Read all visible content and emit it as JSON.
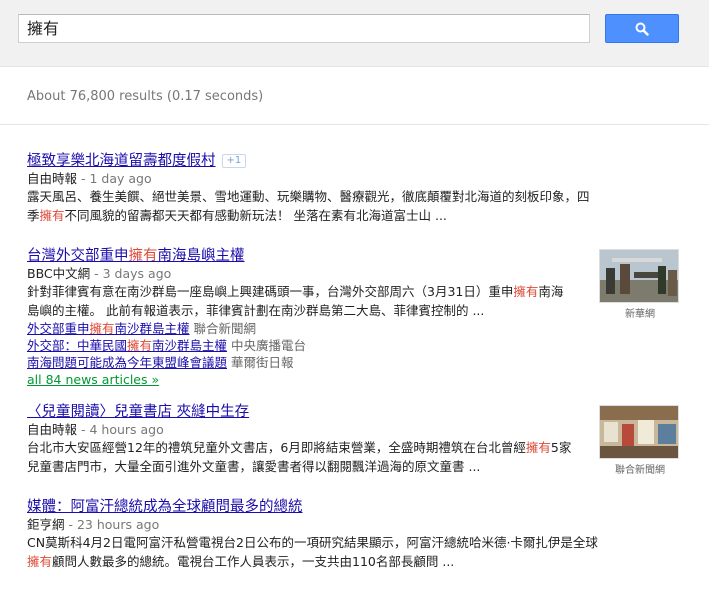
{
  "search": {
    "query": "擁有"
  },
  "stats": "About 76,800 results (0.17 seconds)",
  "results": [
    {
      "title_parts": [
        "極致享樂北海道留壽都度假村",
        "",
        ""
      ],
      "plus_badge": "+1",
      "source": "自由時報",
      "time": " - 1 day ago",
      "snippet_lines": [
        [
          "露天風呂、養生美饌、絕世美景、雪地運動、玩樂購物、醫療觀光，徹底顛覆對北海道的刻板印象，四",
          "",
          ""
        ],
        [
          "季",
          "擁有",
          "不同風貌的留壽都天天都有感動新玩法！ 坐落在素有北海道富士山 ..."
        ]
      ]
    },
    {
      "title_parts": [
        "台灣外交部重申",
        "擁有",
        "南海島嶼主權"
      ],
      "source": "BBC中文網",
      "time": " - 3 days ago",
      "snippet_lines": [
        [
          "針對菲律賓有意在南沙群島一座島嶼上興建碼頭一事，台灣外交部周六（3月31日）重申",
          "擁有",
          "南海"
        ],
        [
          "島嶼的主權。 此前有報道表示，菲律賓計劃在南沙群島第二大島、菲律賓控制的 ...",
          "",
          ""
        ]
      ],
      "sublinks": [
        {
          "parts": [
            "外交部重申",
            "擁有",
            "南沙群島主權"
          ],
          "source": "聯合新聞網"
        },
        {
          "parts": [
            "外交部：中華民國",
            "擁有",
            "南沙群島主權"
          ],
          "source": "中央廣播電台"
        },
        {
          "parts": [
            "南海問題可能成為今年東盟峰會議題",
            "",
            ""
          ],
          "source": "華爾街日報"
        }
      ],
      "all_articles": "all 84 news articles »",
      "thumb_caption": "新華網"
    },
    {
      "title_parts": [
        "〈兒童閱讀〉兒童書店 夾縫中生存",
        "",
        ""
      ],
      "source": "自由時報",
      "time": " - 4 hours ago",
      "snippet_lines": [
        [
          "台北市大安區經營12年的禮筑兒童外文書店，6月即將結束營業，全盛時期禮筑在台北曾經",
          "擁有",
          "5家"
        ],
        [
          "兒童書店門市，大量全面引進外文童書，讓愛書者得以翻閱飄洋過海的原文童書 ...",
          "",
          ""
        ]
      ],
      "thumb_caption": "聯合新聞網"
    },
    {
      "title_parts": [
        "媒體：阿富汗總統成為全球顧問最多的總統",
        "",
        ""
      ],
      "source": "鉅亨網",
      "time": " - 23 hours ago",
      "snippet_lines": [
        [
          "CN莫斯科4月2日電阿富汗私營電視台2日公布的一項研究結果顯示，阿富汗總統哈米德·卡爾扎伊是全球",
          "",
          ""
        ],
        [
          "",
          "擁有",
          "顧問人數最多的總統。電視台工作人員表示，一支共由110名部長顧問 ..."
        ]
      ]
    }
  ],
  "colors": {
    "link": "#1a0dab",
    "highlight": "#dd4b39",
    "green": "#009933",
    "button": "#4d90fe"
  },
  "icons": {
    "search_button": "magnifier-icon"
  }
}
